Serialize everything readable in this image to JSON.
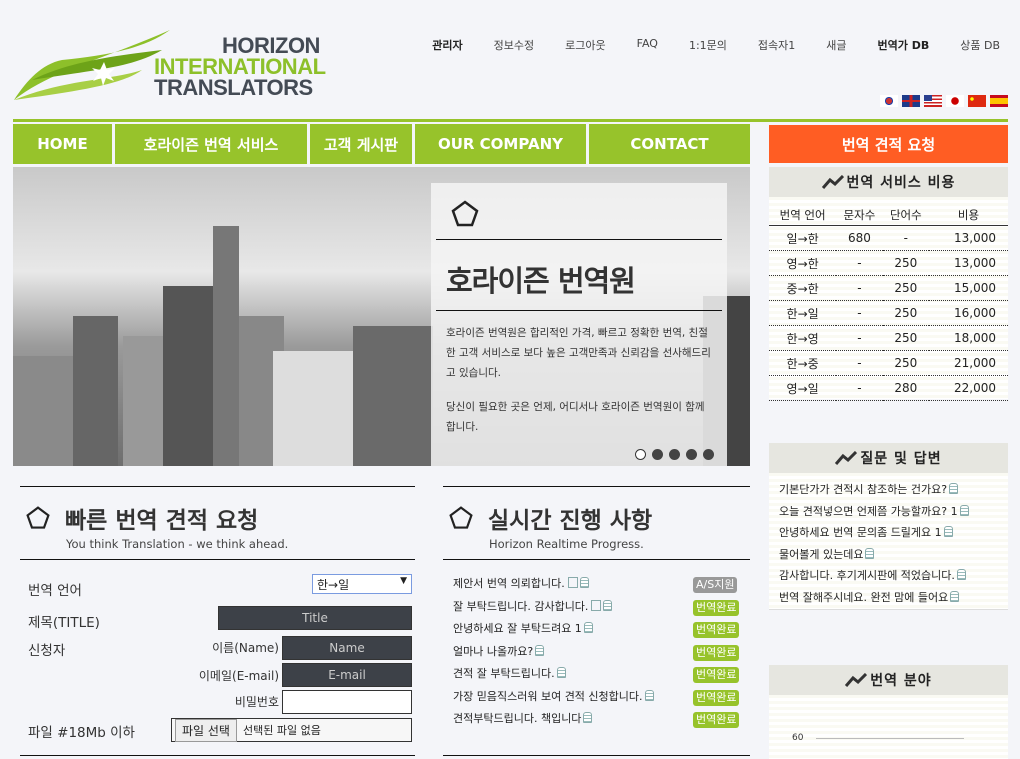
{
  "brand": {
    "l1": "HORIZON",
    "l2": "INTERNATIONAL",
    "l3": "TRANSLATORS"
  },
  "topnav": [
    "관리자",
    "정보수정",
    "로그아웃",
    "FAQ",
    "1:1문의",
    "접속자1",
    "새글",
    "번역가 DB",
    "상품 DB"
  ],
  "flags": [
    "korea",
    "uk",
    "usa",
    "japan",
    "china",
    "spain"
  ],
  "nav": [
    "HOME",
    "호라이즌 번역 서비스",
    "고객 게시판",
    "OUR COMPANY",
    "CONTACT"
  ],
  "quote_button": "번역 견적 요청",
  "hero": {
    "title": "호라이즌 번역원",
    "p1": "호라이즌 번역원은 합리적인 가격, 빠르고 정확한 번역, 친절한 고객 서비스로 보다 높은 고객만족과 신뢰감을 선사해드리고 있습니다.",
    "p2": "당신이 필요한 곳은 언제, 어디서나 호라이즌 번역원이 함께합니다.",
    "slides": 5,
    "active_slide": 1
  },
  "pricing": {
    "title": "번역 서비스 비용",
    "headers": [
      "번역 언어",
      "문자수",
      "단어수",
      "비용"
    ],
    "rows": [
      [
        "일→한",
        "680",
        "-",
        "13,000"
      ],
      [
        "영→한",
        "-",
        "250",
        "13,000"
      ],
      [
        "중→한",
        "-",
        "250",
        "15,000"
      ],
      [
        "한→일",
        "-",
        "250",
        "16,000"
      ],
      [
        "한→영",
        "-",
        "250",
        "18,000"
      ],
      [
        "한→중",
        "-",
        "250",
        "21,000"
      ],
      [
        "영→일",
        "-",
        "280",
        "22,000"
      ]
    ]
  },
  "qa": {
    "title": "질문 및 답변",
    "items": [
      "기본단가가 견적시 참조하는 건가요?",
      "오늘 견적넣으면 언제쯤 가능할까요? 1",
      "안녕하세요 번역 문의좀 드릴게요 1",
      "물어볼게 있는데요",
      "감사합니다. 후기게시판에 적었습니다.",
      "번역 잘해주시네요. 완전 맘에 들어요"
    ]
  },
  "field": {
    "title": "번역 분야",
    "axis_tick": "60"
  },
  "quick": {
    "title": "빠른 번역 견적 요청",
    "subtitle": "You think Translation - we think ahead.",
    "lang_label": "번역 언어",
    "lang_value": "한→일",
    "title_label": "제목(TITLE)",
    "title_ph": "Title",
    "applicant": "신청자",
    "name_label": "이름(Name)",
    "name_ph": "Name",
    "email_label": "이메일(E-mail)",
    "email_ph": "E-mail",
    "pw_label": "비밀번호",
    "file_label": "파일 #18Mb 이하",
    "file_btn": "파일 선택",
    "file_none": "선택된 파일 없음"
  },
  "progress": {
    "title": "실시간 진행 사항",
    "subtitle": "Horizon Realtime Progress.",
    "items": [
      {
        "text": "제안서 번역 의뢰합니다.",
        "memo": true,
        "status": "A/S지원",
        "gray": true
      },
      {
        "text": "잘 부탁드립니다. 감사합니다.",
        "memo": true,
        "status": "번역완료"
      },
      {
        "text": "안녕하세요 잘 부탁드려요 1",
        "status": "번역완료"
      },
      {
        "text": "얼마나 나올까요?",
        "status": "번역완료"
      },
      {
        "text": "견적 잘 부탁드립니다.",
        "status": "번역완료"
      },
      {
        "text": "가장 믿음직스러워 보여 견적 신청합니다.",
        "status": "번역완료"
      },
      {
        "text": "견적부탁드립니다. 책입니다",
        "status": "번역완료"
      }
    ]
  }
}
